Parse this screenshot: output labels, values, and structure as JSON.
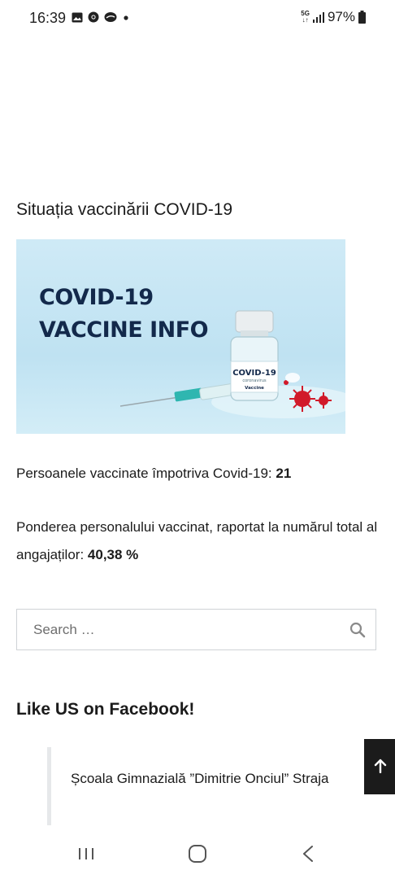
{
  "status_bar": {
    "time": "16:39",
    "network": "5G",
    "battery": "97%",
    "notification_icons": [
      "gallery-icon",
      "chrome-icon",
      "cloud-icon",
      "dot-icon"
    ]
  },
  "main": {
    "section_title": "Situația vaccinării COVID-19",
    "banner": {
      "line1": "COVID-19",
      "line2": "VACCINE INFO",
      "vial_title": "COVID-19",
      "vial_sub": "coronavirus",
      "vial_label": "Vaccine"
    },
    "vaccinated_label": "Persoanele vaccinate împotriva Covid-19:",
    "vaccinated_value": "21",
    "share_label": "Ponderea personalului vaccinat, raportat la numărul total al angajaților:",
    "share_value": "40,38 %"
  },
  "search": {
    "placeholder": "Search …"
  },
  "facebook": {
    "title": "Like US on Facebook!",
    "page_name": "Școala Gimnazială ”Dimitrie Onciul” Straja"
  },
  "colors": {
    "banner_bg": "#c8e7f4",
    "banner_text": "#13294b",
    "scroll_top_bg": "#1b1b1b"
  }
}
